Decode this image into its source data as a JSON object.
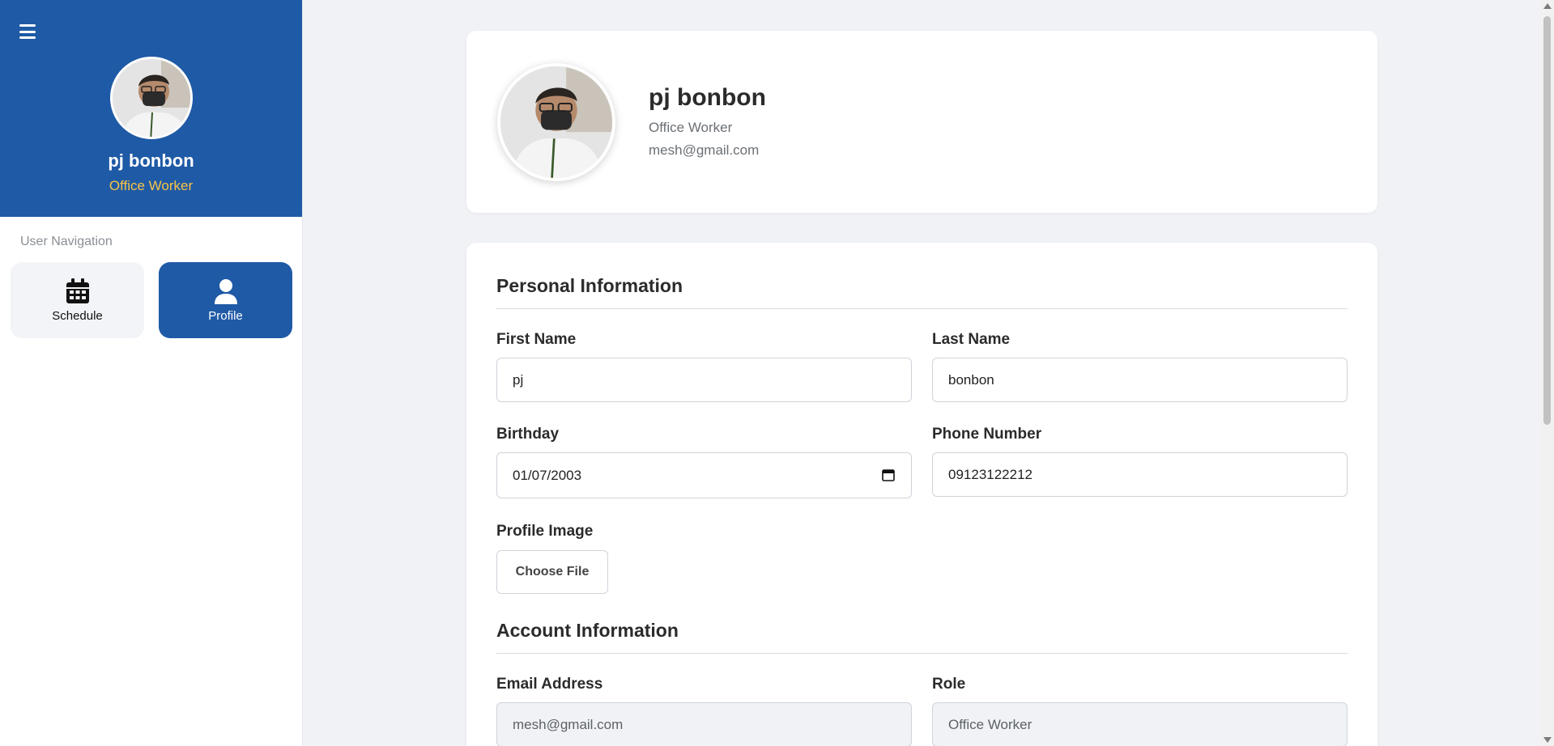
{
  "colors": {
    "primary": "#1f5aa6",
    "role_accent": "#f6c445",
    "background": "#f0f2f5"
  },
  "sidebar": {
    "user": {
      "name": "pj bonbon",
      "role": "Office Worker"
    },
    "nav_label": "User Navigation",
    "items": [
      {
        "label": "Schedule",
        "icon": "calendar-icon",
        "active": false
      },
      {
        "label": "Profile",
        "icon": "user-icon",
        "active": true
      }
    ]
  },
  "profile": {
    "name": "pj bonbon",
    "role": "Office Worker",
    "email": "mesh@gmail.com"
  },
  "personal": {
    "title": "Personal Information",
    "first_name_label": "First Name",
    "first_name": "pj",
    "last_name_label": "Last Name",
    "last_name": "bonbon",
    "birthday_label": "Birthday",
    "birthday": "01/07/2003",
    "phone_label": "Phone Number",
    "phone": "09123122212",
    "image_label": "Profile Image",
    "choose_file": "Choose File"
  },
  "account": {
    "title": "Account Information",
    "email_label": "Email Address",
    "email": "mesh@gmail.com",
    "role_label": "Role",
    "role": "Office Worker"
  }
}
